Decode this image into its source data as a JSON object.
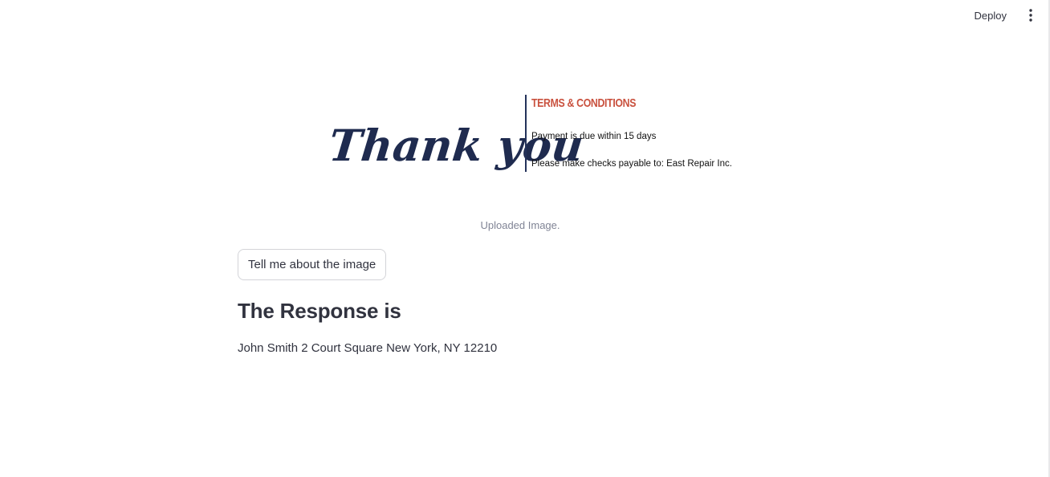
{
  "header": {
    "deploy_label": "Deploy",
    "menu_icon": "vertical-ellipsis-icon"
  },
  "image": {
    "thank_you": "Thank you",
    "terms_title": "TERMS & CONDITIONS",
    "terms_line_1": "Payment is due within 15 days",
    "terms_line_2": "Please make checks payable to: East Repair Inc.",
    "caption": "Uploaded Image."
  },
  "actions": {
    "ask_button_label": "Tell me about the image"
  },
  "response": {
    "heading": "The Response is",
    "text": "John Smith 2 Court Square New York, NY 12210"
  },
  "colors": {
    "script_navy": "#1f2b4f",
    "terms_red": "#c9513e",
    "text": "#31333f",
    "caption": "#808495"
  }
}
